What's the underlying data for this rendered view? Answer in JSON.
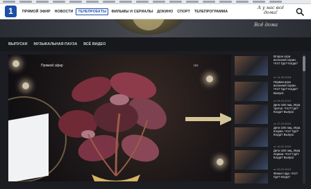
{
  "nav": {
    "logo_text": "1",
    "items": [
      {
        "label": "ПРЯМОЙ ЭФИР",
        "active": false
      },
      {
        "label": "НОВОСТИ",
        "active": false
      },
      {
        "label": "ТЕЛЕПРОЕКТЫ",
        "active": true
      },
      {
        "label": "ФИЛЬМЫ И СЕРИАЛЫ",
        "active": false
      },
      {
        "label": "ДОКИНО",
        "active": false
      },
      {
        "label": "СПОРТ",
        "active": false
      },
      {
        "label": "ТЕЛЕПРОГРАММА",
        "active": false
      }
    ],
    "slogan": "А у нас всё дома!",
    "search_icon": "search-icon"
  },
  "banner": {
    "text": "Всё дома"
  },
  "subnav": {
    "items": [
      "ВЫПУСКИ",
      "МУЗЫКАЛЬНАЯ ПАУЗА",
      "ВСЁ ВИДЕО"
    ]
  },
  "player": {
    "channel_badge": "Прямой эфир",
    "hd_badge": "HD"
  },
  "sidebar": {
    "episodes": [
      {
        "title": "Второе игра весенней серии. Что? Где? Когда?",
        "date": "от 14.03.2018"
      },
      {
        "title": "Первая игра весенней серии. Что? Где? Когда? Выпуск",
        "date": "от 03.03.2019"
      },
      {
        "title": "Дети 100 лиц. Игра третья. Что? Где? Когда? Выпуск",
        "date": "от 27.02.2019"
      },
      {
        "title": "Дети 100 лиц. Игра вторая. Что? Где? Когда? Выпуск",
        "date": "от 10.02.2019"
      },
      {
        "title": "Дети 100 лиц. Игра первая. Что? Где? Когда? Выпуск",
        "date": "от 03.02.2019"
      },
      {
        "title": "Финал года. Что? Где? Когда?",
        "date": ""
      }
    ]
  }
}
